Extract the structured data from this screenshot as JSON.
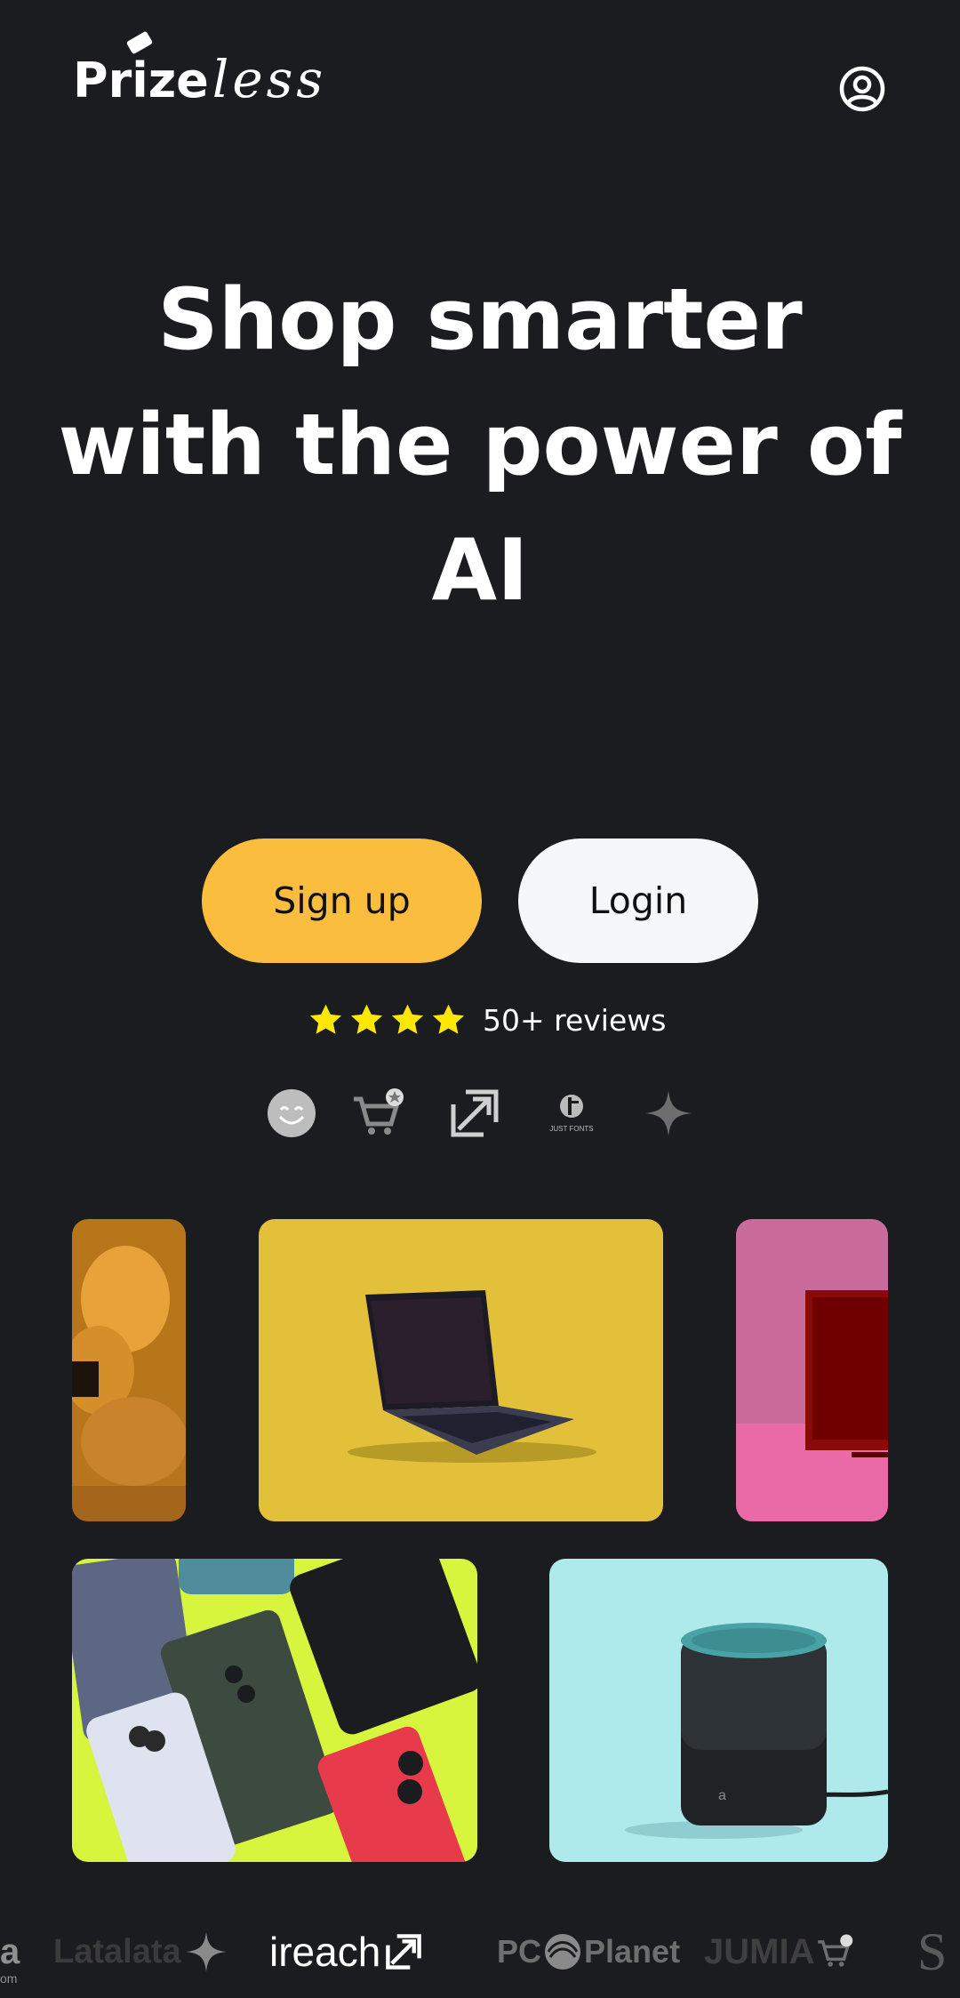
{
  "header": {
    "logo_main": "Prize",
    "logo_script": "less",
    "account_icon": "user-circle-icon"
  },
  "hero": {
    "line1": "Shop smarter",
    "line2": "with the power of",
    "line3": "AI"
  },
  "actions": {
    "signup_label": "Sign up",
    "login_label": "Login"
  },
  "reviews": {
    "stars": 4,
    "text": "50+ reviews",
    "star_color": "#ffe800"
  },
  "partners": [
    "smiley-icon",
    "cart-star-icon",
    "expand-arrow-icon",
    "just-fonts-logo",
    "sparkle-icon"
  ],
  "partner_small_text": "JUST FONTS",
  "products": [
    {
      "name": "dust-explosion-image",
      "bg": "#c98420"
    },
    {
      "name": "laptop-image",
      "bg": "#e2c03a"
    },
    {
      "name": "monitor-image",
      "bg": "#d75a9a"
    },
    {
      "name": "phones-image",
      "bg": "#d6f53c"
    },
    {
      "name": "speaker-image",
      "bg": "#aeeaec"
    }
  ],
  "brands": {
    "b1": "a",
    "b1_small": "om",
    "b2": "Latalata",
    "b3": "ireach",
    "b4a": "PC",
    "b4b": "Planet",
    "b5": "JUMIA",
    "b6": "S"
  },
  "colors": {
    "background": "#1b1c1f",
    "accent": "#fbbd3e",
    "login_bg": "#f6f7f9"
  }
}
